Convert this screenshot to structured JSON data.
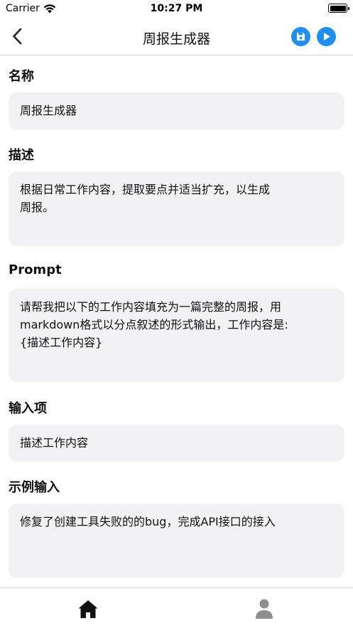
{
  "status_bar": {
    "carrier": "Carrier",
    "time": "10:27 PM"
  },
  "nav": {
    "title": "周报生成器",
    "back_icon": "chevron-left-icon",
    "save_icon": "save-icon",
    "run_icon": "play-icon",
    "accent_color": "#1e8ff0"
  },
  "form": {
    "name": {
      "label": "名称",
      "value": "周报生成器"
    },
    "description": {
      "label": "描述",
      "value": "根据日常工作内容，提取要点并适当扩充，以生成\n周报。"
    },
    "prompt": {
      "label": "Prompt",
      "value": "请帮我把以下的工作内容填充为一篇完整的周报，用\nmarkdown格式以分点叙述的形式输出，工作内容是:\n{描述工作内容}"
    },
    "input_item": {
      "label": "输入项",
      "value": "描述工作内容"
    },
    "example_input": {
      "label": "示例输入",
      "value": "修复了创建工具失败的的bug，完成API接口的接入"
    }
  },
  "tab_bar": {
    "home_icon": "home-icon",
    "profile_icon": "person-icon",
    "active_color": "#111111",
    "inactive_color": "#8e8e93"
  }
}
